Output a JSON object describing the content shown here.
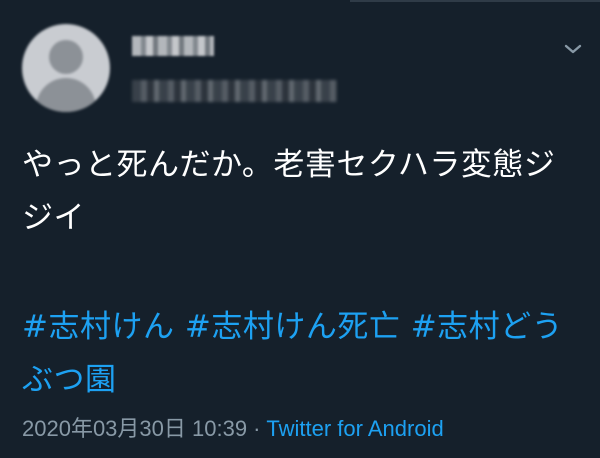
{
  "tweet": {
    "text": "やっと死んだか。老害セクハラ変態ジジイ",
    "hashtags": [
      "#志村けん",
      "#志村けん死亡",
      "#志村どうぶつ園"
    ],
    "timestamp": "2020年03月30日 10:39",
    "separator": "·",
    "source": "Twitter for Android"
  },
  "icons": {
    "more": "chevron-down-icon",
    "avatar": "default-user-avatar-icon"
  },
  "colors": {
    "background": "#15202b",
    "text": "#ffffff",
    "muted": "#8899a6",
    "link": "#1da1f2"
  }
}
